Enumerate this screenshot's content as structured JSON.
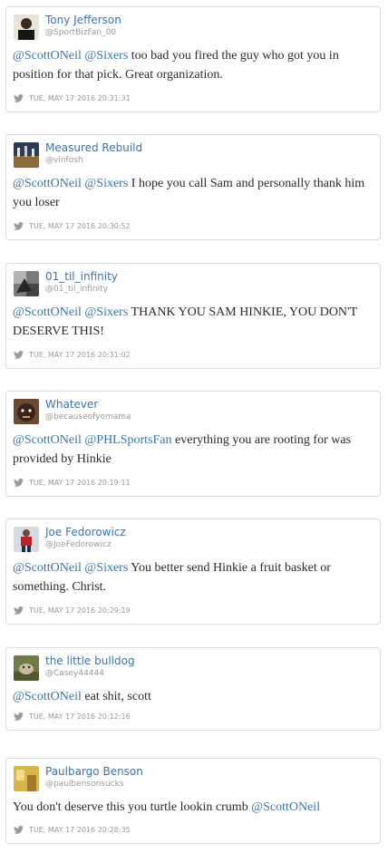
{
  "tweets": [
    {
      "name": "Tony Jefferson",
      "handle": "@SportBizFan_00",
      "avatar": "photo-man-dark-shirt",
      "segments": [
        {
          "t": "@ScottONeil",
          "m": true
        },
        {
          "t": " ",
          "m": false
        },
        {
          "t": "@Sixers",
          "m": true
        },
        {
          "t": " too bad you fired the guy who got you in position for that pick. Great organization.",
          "m": false
        }
      ],
      "timestamp": "TUE, MAY 17 2016 20:31:31"
    },
    {
      "name": "Measured Rebuild",
      "handle": "@vinfosh",
      "avatar": "photo-basketball-court",
      "segments": [
        {
          "t": "@ScottONeil",
          "m": true
        },
        {
          "t": " ",
          "m": false
        },
        {
          "t": "@Sixers",
          "m": true
        },
        {
          "t": " I hope you call Sam and personally thank him you loser",
          "m": false
        }
      ],
      "timestamp": "TUE, MAY 17 2016 20:30:52"
    },
    {
      "name": "01_til_infinity",
      "handle": "@01_til_infinity",
      "avatar": "photo-grayscale",
      "segments": [
        {
          "t": "@ScottONeil",
          "m": true
        },
        {
          "t": " ",
          "m": false
        },
        {
          "t": "@Sixers",
          "m": true
        },
        {
          "t": " THANK YOU SAM HINKIE, YOU DON'T DESERVE THIS!",
          "m": false
        }
      ],
      "timestamp": "TUE, MAY 17 2016 20:31:02"
    },
    {
      "name": "Whatever",
      "handle": "@becauseofyomama",
      "avatar": "photo-face-closeup",
      "segments": [
        {
          "t": "@ScottONeil",
          "m": true
        },
        {
          "t": " ",
          "m": false
        },
        {
          "t": "@PHLSportsFan",
          "m": true
        },
        {
          "t": " everything you are rooting for was provided by Hinkie",
          "m": false
        }
      ],
      "timestamp": "TUE, MAY 17 2016 20:19:11"
    },
    {
      "name": "Joe Fedorowicz",
      "handle": "@JoeFedorowicz",
      "avatar": "photo-player-red",
      "segments": [
        {
          "t": "@ScottONeil",
          "m": true
        },
        {
          "t": " ",
          "m": false
        },
        {
          "t": "@Sixers",
          "m": true
        },
        {
          "t": " You better send Hinkie a fruit basket or something. Christ.",
          "m": false
        }
      ],
      "timestamp": "TUE, MAY 17 2016 20:29:19"
    },
    {
      "name": "the little bulldog",
      "handle": "@Casey44444",
      "avatar": "photo-bulldog-outdoors",
      "segments": [
        {
          "t": "@ScottONeil",
          "m": true
        },
        {
          "t": " eat shit, scott",
          "m": false
        }
      ],
      "timestamp": "TUE, MAY 17 2016 20:12:16"
    },
    {
      "name": "Paulbargo Benson",
      "handle": "@paulbensonsucks",
      "avatar": "photo-yellow-room",
      "segments": [
        {
          "t": "You don't deserve this you turtle lookin crumb ",
          "m": false
        },
        {
          "t": "@ScottONeil",
          "m": true
        }
      ],
      "timestamp": "TUE, MAY 17 2016 20:28:35"
    }
  ],
  "colors": {
    "link": "#3b74b3",
    "text": "#2b2b2b",
    "meta": "#9a9a9a",
    "border": "#dcdcdc"
  },
  "icons": {
    "timestamp": "twitter-bird-icon"
  }
}
